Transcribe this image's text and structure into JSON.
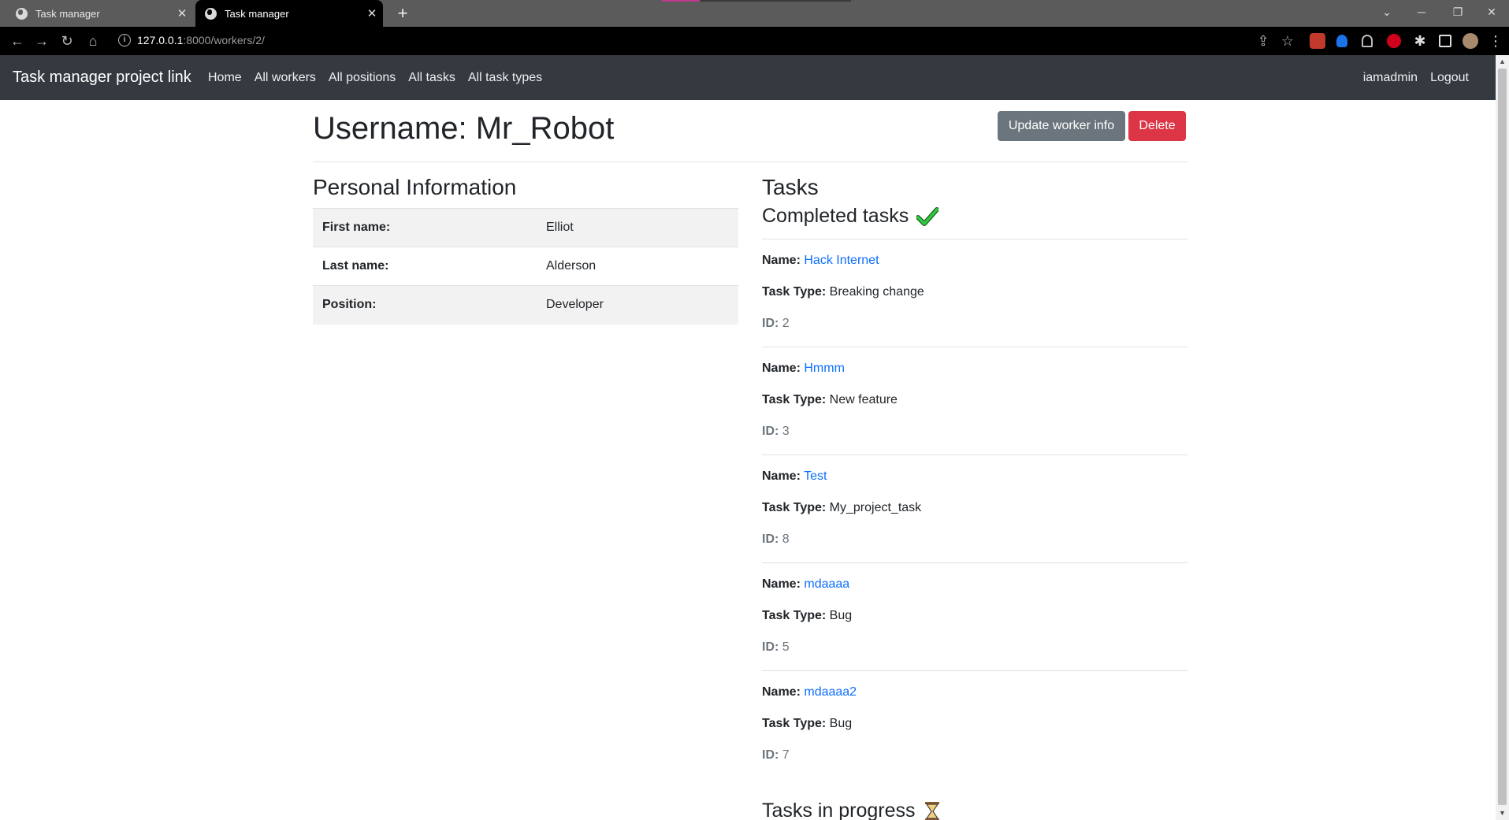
{
  "browser": {
    "tabs": [
      {
        "title": "Task manager",
        "active": false
      },
      {
        "title": "Task manager",
        "active": true
      }
    ],
    "new_tab": "+",
    "url_host": "127.0.0.1",
    "url_path": ":8000/workers/2/"
  },
  "navbar": {
    "brand": "Task manager project link",
    "links": [
      "Home",
      "All workers",
      "All positions",
      "All tasks",
      "All task types"
    ],
    "user": "iamadmin",
    "logout": "Logout"
  },
  "page": {
    "title": "Username: Mr_Robot",
    "update_button": "Update worker info",
    "delete_button": "Delete"
  },
  "personal": {
    "heading": "Personal Information",
    "rows": [
      {
        "label": "First name:",
        "value": "Elliot"
      },
      {
        "label": "Last name:",
        "value": "Alderson"
      },
      {
        "label": "Position:",
        "value": "Developer"
      }
    ]
  },
  "tasks": {
    "heading": "Tasks",
    "completed_heading": "Completed tasks",
    "name_label": "Name:",
    "type_label": "Task Type:",
    "id_label": "ID:",
    "completed": [
      {
        "name": "Hack Internet",
        "type": "Breaking change",
        "id": "2"
      },
      {
        "name": "Hmmm",
        "type": "New feature",
        "id": "3"
      },
      {
        "name": "Test",
        "type": "My_project_task",
        "id": "8"
      },
      {
        "name": "mdaaaa",
        "type": "Bug",
        "id": "5"
      },
      {
        "name": "mdaaaa2",
        "type": "Bug",
        "id": "7"
      }
    ],
    "in_progress_heading": "Tasks in progress"
  },
  "colors": {
    "navbar": "#343a40",
    "link": "#0d6efd",
    "secondary": "#6c757d",
    "danger": "#dc3545",
    "check": "#28a745"
  }
}
